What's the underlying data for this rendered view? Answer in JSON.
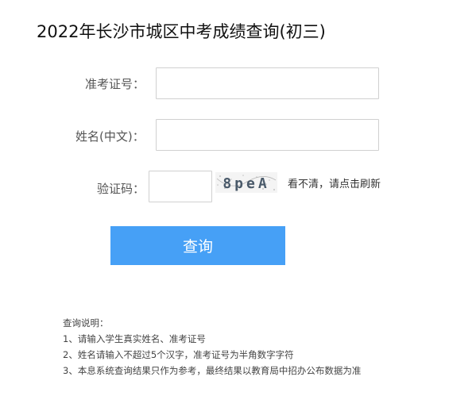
{
  "page": {
    "title": "2022年长沙市城区中考成绩查询(初三)"
  },
  "form": {
    "exam_id": {
      "label": "准考证号：",
      "value": ""
    },
    "name": {
      "label": "姓名(中文)：",
      "value": ""
    },
    "captcha": {
      "label": "验证码：",
      "value": "",
      "image_text": "8peA",
      "refresh_text": "看不清，请点击刷新"
    },
    "submit_label": "查询"
  },
  "notes": {
    "heading": "查询说明：",
    "items": [
      "1、请输入学生真实姓名、准考证号",
      "2、姓名请输入不超过5个汉字，准考证号为半角数字字符",
      "3、本息系统查询结果只作为参考，最终结果以教育局中招办公布数据为准"
    ]
  },
  "colors": {
    "button": "#46a0f6",
    "input_border": "#d0d0d0"
  }
}
